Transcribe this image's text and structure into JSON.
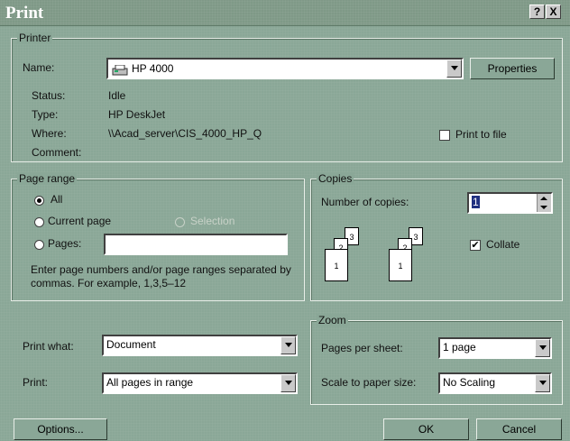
{
  "window": {
    "title": "Print",
    "help_button": "?",
    "close_button": "X"
  },
  "printer": {
    "group_label": "Printer",
    "name_label": "Name:",
    "name_value": "HP 4000",
    "properties_button": "Properties",
    "status_label": "Status:",
    "status_value": "Idle",
    "type_label": "Type:",
    "type_value": "HP DeskJet",
    "where_label": "Where:",
    "where_value": "\\\\Acad_server\\CIS_4000_HP_Q",
    "comment_label": "Comment:",
    "print_to_file_label": "Print to file",
    "print_to_file_checked": false
  },
  "page_range": {
    "group_label": "Page range",
    "all_label": "All",
    "current_page_label": "Current page",
    "selection_label": "Selection",
    "pages_label": "Pages:",
    "pages_value": "",
    "selected": "All",
    "hint": "Enter page numbers and/or page ranges separated by commas.  For example, 1,3,5–12"
  },
  "copies": {
    "group_label": "Copies",
    "number_label": "Number of copies:",
    "number_value": "1",
    "collate_label": "Collate",
    "collate_checked": true,
    "page_numbers": [
      "3",
      "2",
      "1"
    ]
  },
  "print_what": {
    "label": "Print what:",
    "value": "Document"
  },
  "print": {
    "label": "Print:",
    "value": "All pages in range"
  },
  "zoom": {
    "group_label": "Zoom",
    "pages_per_sheet_label": "Pages per sheet:",
    "pages_per_sheet_value": "1 page",
    "scale_label": "Scale to paper size:",
    "scale_value": "No Scaling"
  },
  "buttons": {
    "options": "Options...",
    "ok": "OK",
    "cancel": "Cancel"
  }
}
